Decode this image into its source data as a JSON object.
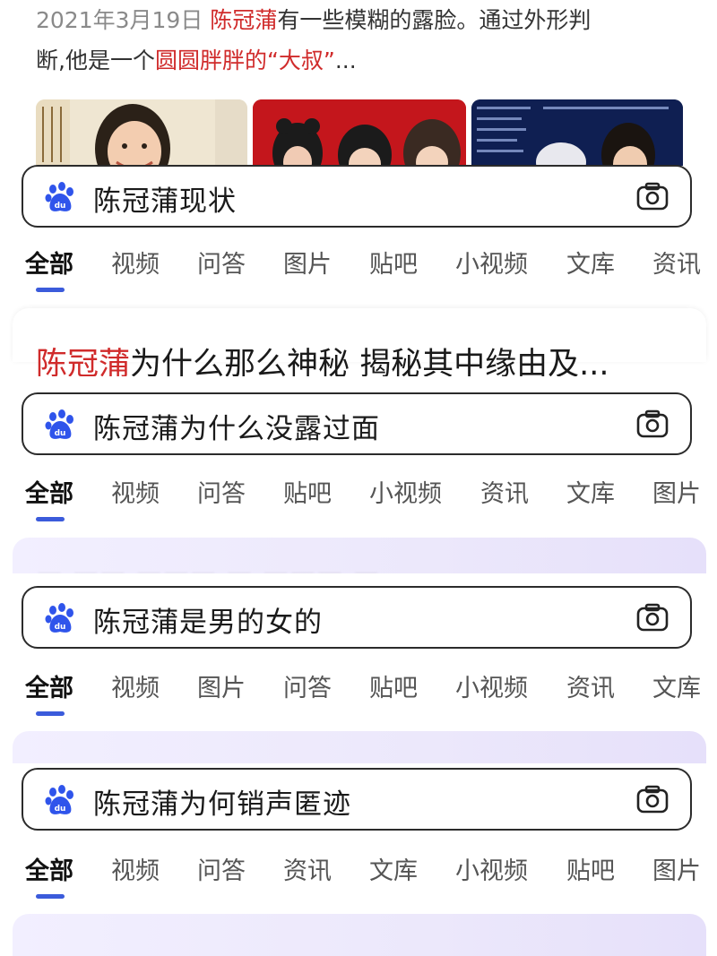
{
  "top_result": {
    "snippet_line1": {
      "date": "2021年3月19日",
      "hl": "陈冠蒲",
      "rest": "有一些模糊的露脸。通过外形判"
    },
    "snippet_line2": {
      "pre": "断,他是一个",
      "hl": "圆圆胖胖的“大叔”",
      "post": "..."
    }
  },
  "tab_label_strings": {
    "all": "全部",
    "video": "视频",
    "qa": "问答",
    "image": "图片",
    "tieba": "贴吧",
    "short_video": "小视频",
    "wenku": "文库",
    "news": "资讯"
  },
  "search_panels": [
    {
      "query": "陈冠蒲现状",
      "tabs": [
        "全部",
        "视频",
        "问答",
        "图片",
        "贴吧",
        "小视频",
        "文库",
        "资讯"
      ]
    },
    {
      "query": "陈冠蒲为什么没露过面",
      "tabs": [
        "全部",
        "视频",
        "问答",
        "贴吧",
        "小视频",
        "资讯",
        "文库",
        "图片"
      ]
    },
    {
      "query": "陈冠蒲是男的女的",
      "tabs": [
        "全部",
        "视频",
        "图片",
        "问答",
        "贴吧",
        "小视频",
        "资讯",
        "文库"
      ]
    },
    {
      "query": "陈冠蒲为何销声匿迹",
      "tabs": [
        "全部",
        "视频",
        "问答",
        "资讯",
        "文库",
        "小视频",
        "贴吧",
        "图片"
      ]
    }
  ],
  "result_title_1": {
    "hl": "陈冠蒲",
    "rest": "为什么那么神秘 揭秘其中缘由及..."
  },
  "colors": {
    "highlight": "#d02b2b",
    "brand_blue": "#2f54eb",
    "tab_indicator": "#3b5bdb"
  },
  "icons": [
    "baidu-paw-icon",
    "camera-icon"
  ]
}
